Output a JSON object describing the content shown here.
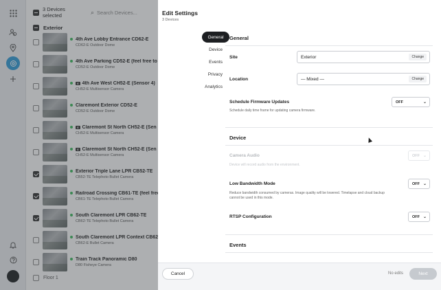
{
  "rail": {
    "icons": [
      "grid-icon",
      "users-icon",
      "location-pin-icon",
      "camera-icon",
      "plus-icon",
      "bell-icon",
      "help-icon"
    ]
  },
  "device_list": {
    "selected_label": "3 Devices selected",
    "search_placeholder": "Search Devices...",
    "group": "Exterior",
    "footer_group": "Floor 1",
    "rows": [
      {
        "name": "4th Ave Lobby Entrance CD62-E",
        "model": "CD62-E Outdoor Dome",
        "checked": false,
        "badge": ""
      },
      {
        "name": "4th Ave Parking CD52-E (feel free to zo",
        "model": "CD52-E Outdoor Dome",
        "checked": false,
        "badge": ""
      },
      {
        "name": "4th Ave West CH52-E (Sensor 4)",
        "model": "CH52-E Multisensor Camera",
        "checked": false,
        "badge": "4"
      },
      {
        "name": "Claremont Exterior CD52-E",
        "model": "CD52-E Outdoor Dome",
        "checked": false,
        "badge": ""
      },
      {
        "name": "Claremont St North CH52-E (Sen",
        "model": "CH52-E Multisensor Camera",
        "checked": false,
        "badge": "4"
      },
      {
        "name": "Claremont St North CH52-E (Sen",
        "model": "CH52-E Multisensor Camera",
        "checked": false,
        "badge": "4"
      },
      {
        "name": "Exterior Triple Lane LPR CB52-TE",
        "model": "CB52-TE Telephoto Bullet Camera",
        "checked": true,
        "badge": ""
      },
      {
        "name": "Railroad Crossing CB61-TE (feel free to",
        "model": "CB61-TE Telephoto Bullet Camera",
        "checked": true,
        "badge": ""
      },
      {
        "name": "South Claremont LPR CB62-TE",
        "model": "CB62-TE Telephoto Bullet Camera",
        "checked": true,
        "badge": ""
      },
      {
        "name": "South Claremont LPR Context CB62-E",
        "model": "CB62-E Bullet Camera",
        "checked": false,
        "badge": ""
      },
      {
        "name": "Train Track Panoramic D80",
        "model": "D80 Fisheye Camera",
        "checked": false,
        "badge": ""
      }
    ]
  },
  "modal": {
    "title": "Edit Settings",
    "subtitle": "3 Devices",
    "nav": [
      "General",
      "Device",
      "Events",
      "Privacy",
      "Analytics"
    ],
    "general": {
      "title": "General",
      "site_label": "Site",
      "site_value": "Exterior",
      "location_label": "Location",
      "location_value": "— Mixed —",
      "change_label": "Change",
      "firmware_label": "Schedule Firmware Updates",
      "firmware_desc": "Schedule daily time frame for updating camera firmware.",
      "firmware_value": "OFF"
    },
    "device": {
      "title": "Device",
      "audio_label": "Camera Audio",
      "audio_desc": "Device will record audio from the environment.",
      "audio_value": "OFF",
      "bandwidth_label": "Low Bandwidth Mode",
      "bandwidth_desc": "Reduce bandwidth consumed by cameras. Image quality will be lowered. Timelapse and cloud backup cannot be used in this mode.",
      "bandwidth_value": "OFF",
      "rtsp_label": "RTSP Configuration",
      "rtsp_value": "OFF"
    },
    "events": {
      "title": "Events"
    },
    "footer": {
      "cancel": "Cancel",
      "status": "No edits",
      "next": "Next"
    }
  },
  "colors": {
    "accent": "#2f9bd8",
    "status_online": "#3dbb5d",
    "nav_active": "#1d1f22",
    "next_disabled": "#c6cacf"
  }
}
